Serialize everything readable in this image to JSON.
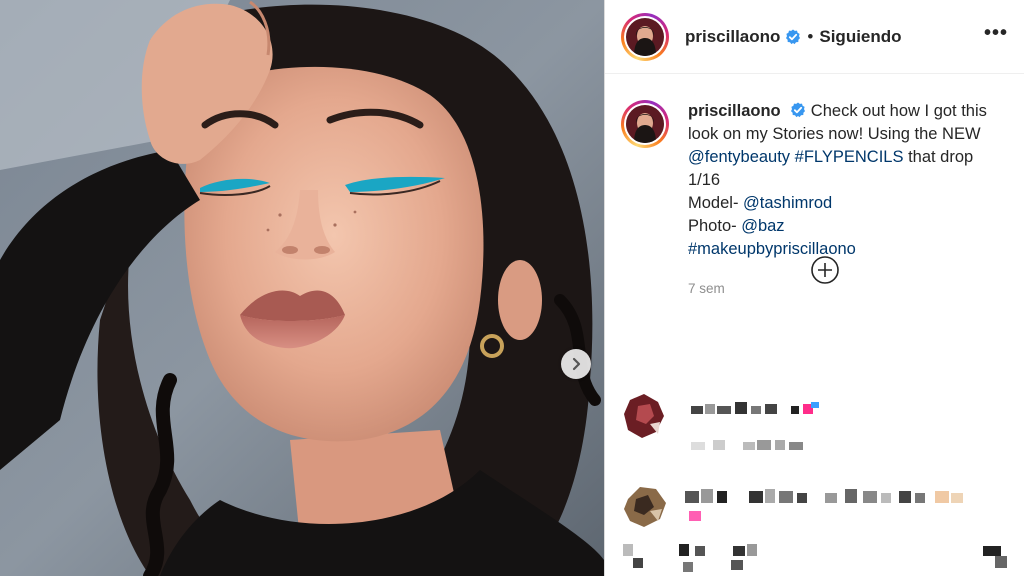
{
  "header": {
    "username": "priscillaono",
    "separator": "•",
    "follow_state": "Siguiendo",
    "more_label": "•••"
  },
  "post": {
    "caption_user": "priscillaono",
    "caption_lines": {
      "l1": "Check out how I got this",
      "l2": "look on my Stories now! Using the NEW",
      "tag_brand": "@fentybeauty",
      "tag_flypencils": "#FLYPENCILS",
      "l3_tail": " that drop",
      "l4": "1/16",
      "model_label": "Model- ",
      "model_tag": "@tashimrod",
      "photo_label": "Photo- ",
      "photo_tag": "@baz",
      "hashtag": "#makeupbypriscillaono"
    },
    "timestamp": "7 sem"
  },
  "icons": {
    "verified": "verified-badge-icon",
    "next": "chevron-right-icon",
    "load_more": "plus-circle-icon",
    "more": "more-options-icon"
  },
  "colors": {
    "link": "#00376b",
    "verified_blue": "#3897f0",
    "eyeliner": "#1aa6c4",
    "meta_gray": "#8e8e8e"
  }
}
